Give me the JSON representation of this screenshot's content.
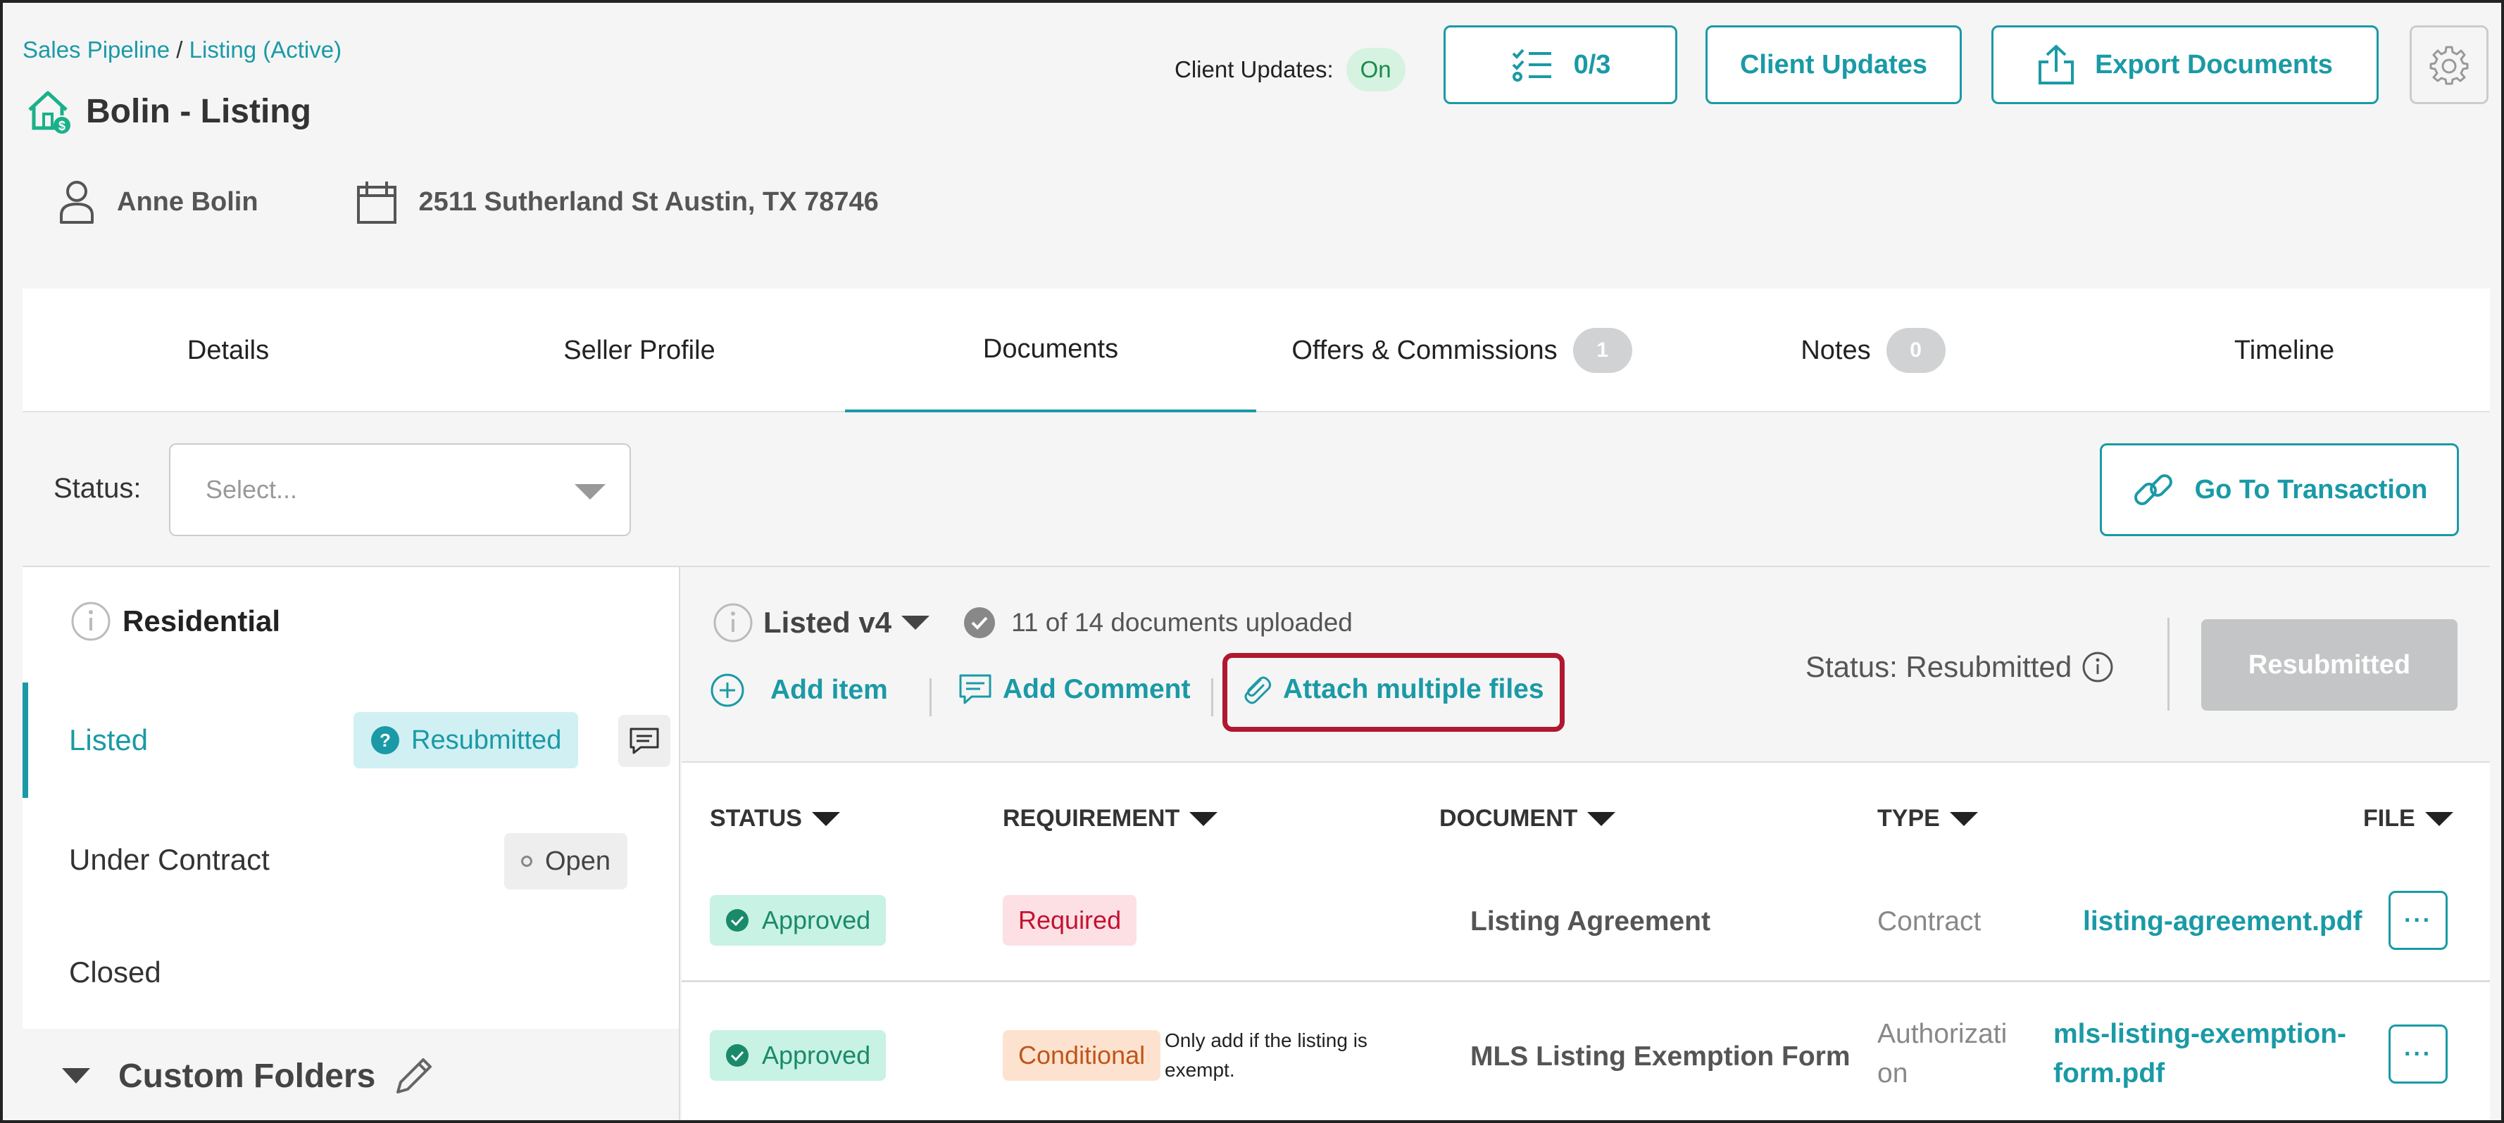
{
  "breadcrumb": {
    "part1": "Sales Pipeline",
    "sep": " / ",
    "part2": "Listing (Active)"
  },
  "page_title": "Bolin - Listing",
  "contact": {
    "name": "Anne Bolin",
    "address": "2511 Sutherland St Austin, TX 78746"
  },
  "header": {
    "client_updates_label": "Client Updates:",
    "client_updates_toggle": "On",
    "tasks_count": "0/3",
    "client_updates_button": "Client Updates",
    "export_button": "Export Documents"
  },
  "tabs": [
    {
      "label": "Details"
    },
    {
      "label": "Seller Profile"
    },
    {
      "label": "Documents"
    },
    {
      "label": "Offers & Commissions",
      "count": "1"
    },
    {
      "label": "Notes",
      "count": "0"
    },
    {
      "label": "Timeline"
    }
  ],
  "active_tab": "Documents",
  "filter": {
    "status_label": "Status:",
    "placeholder": "Select..."
  },
  "go_to_transaction": "Go To Transaction",
  "sidebar": {
    "section_title": "Residential",
    "items": [
      {
        "label": "Listed",
        "badge": "Resubmitted"
      },
      {
        "label": "Under Contract",
        "badge": "Open"
      },
      {
        "label": "Closed"
      }
    ],
    "custom_folders": "Custom Folders"
  },
  "checklist": {
    "version": "Listed v4",
    "uploaded": "11 of 14 documents uploaded",
    "add_item": "Add item",
    "add_comment": "Add Comment",
    "attach_files": "Attach multiple files",
    "status_text": "Status: Resubmitted",
    "status_button": "Resubmitted"
  },
  "table": {
    "headers": [
      "STATUS",
      "REQUIREMENT",
      "DOCUMENT",
      "TYPE",
      "FILE"
    ],
    "rows": [
      {
        "status": "Approved",
        "requirement": "Required",
        "note": "",
        "document": "Listing Agreement",
        "type": "Contract",
        "file": "listing-agreement.pdf"
      },
      {
        "status": "Approved",
        "requirement": "Conditional",
        "note": "Only add if the listing is exempt.",
        "document": "MLS Listing Exemption Form",
        "type_line1": "Authorizati",
        "type_line2": "on",
        "file_line1": "mls-listing-exemption-",
        "file_line2": "form.pdf"
      }
    ],
    "row_menu": "···"
  },
  "colors": {
    "accent": "#1a9aa6",
    "highlight": "#b0182f",
    "approved_bg": "#c8f2e4",
    "approved_fg": "#1a8a6a",
    "required_bg": "#fde0e4",
    "required_fg": "#c41230",
    "conditional_bg": "#fde3cf",
    "conditional_fg": "#c0551a"
  }
}
